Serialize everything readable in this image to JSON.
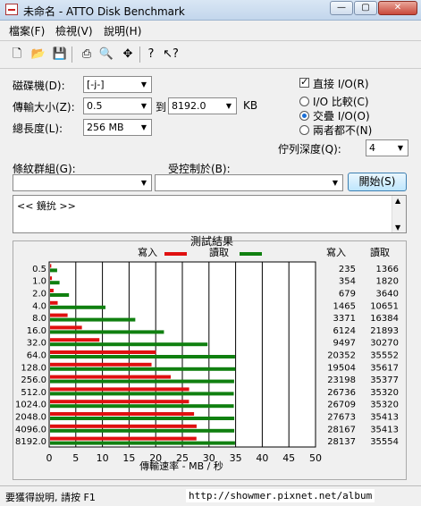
{
  "window": {
    "title": "未命名 - ATTO Disk Benchmark",
    "minimize_glyph": "—",
    "maximize_glyph": "▢",
    "close_glyph": "✕"
  },
  "menu": [
    "檔案(F)",
    "檢視(V)",
    "說明(H)"
  ],
  "toolbar_icons": [
    "new-file-icon",
    "open-folder-icon",
    "save-icon",
    "print-icon",
    "print-preview-icon",
    "move-icon",
    "help-icon",
    "context-help-icon"
  ],
  "form": {
    "drive_label": "磁碟機(D):",
    "drive_value": "[-j-]",
    "transfer_size_label": "傳輸大小(Z):",
    "transfer_from": "0.5",
    "transfer_to_label": "到",
    "transfer_to": "8192.0",
    "transfer_unit": "KB",
    "total_length_label": "總長度(L):",
    "total_length_value": "256 MB",
    "direct_io_label": "直接 I/O(R)",
    "io_compare_label": "I/O 比較(C)",
    "overlapped_io_label": "交疊 I/O(O)",
    "neither_label": "兩者都不(N)",
    "queue_depth_label": "佇列深度(Q):",
    "queue_depth_value": "4",
    "pattern_label": "條紋群組(G):",
    "controlled_by_label": "受控制於(B):",
    "start_button": "開始(S)",
    "description_text": "<< 鏡抁 >>"
  },
  "results": {
    "title": "測試結果",
    "write_legend": "寫入",
    "read_legend": "讀取",
    "col_write": "寫入",
    "col_read": "讀取"
  },
  "colors": {
    "write": "#e01010",
    "read": "#108010",
    "accent": "#1a6ed6"
  },
  "chart_data": {
    "type": "bar",
    "orientation": "horizontal",
    "title": "測試結果",
    "xlabel": "傳輸速率 - MB / 秒",
    "xlim": [
      0,
      50
    ],
    "xticks": [
      "0",
      "5",
      "10",
      "15",
      "20",
      "25",
      "30",
      "35",
      "40",
      "45",
      "50"
    ],
    "categories": [
      "0.5",
      "1.0",
      "2.0",
      "4.0",
      "8.0",
      "16.0",
      "32.0",
      "64.0",
      "128.0",
      "256.0",
      "512.0",
      "1024.0",
      "2048.0",
      "4096.0",
      "8192.0"
    ],
    "series": [
      {
        "name": "寫入",
        "values": [
          0.23,
          0.35,
          0.66,
          1.43,
          3.29,
          5.98,
          9.27,
          19.88,
          19.05,
          22.65,
          26.11,
          26.08,
          27.03,
          27.51,
          27.48
        ]
      },
      {
        "name": "讀取",
        "values": [
          1.33,
          1.78,
          3.55,
          10.4,
          16.0,
          21.38,
          29.56,
          34.72,
          34.78,
          34.55,
          34.49,
          34.49,
          34.58,
          34.58,
          34.72
        ]
      }
    ],
    "write_values_text": [
      "235",
      "354",
      "679",
      "1465",
      "3371",
      "6124",
      "9497",
      "20352",
      "19504",
      "23198",
      "26736",
      "26709",
      "27673",
      "28167",
      "28137"
    ],
    "read_values_text": [
      "1366",
      "1820",
      "3640",
      "10651",
      "16384",
      "21893",
      "30270",
      "35552",
      "35617",
      "35377",
      "35320",
      "35320",
      "35413",
      "35413",
      "35554"
    ],
    "grid": true
  },
  "status": {
    "text": "要獲得說明, 請按 F1",
    "url": "http://showmer.pixnet.net/album"
  }
}
